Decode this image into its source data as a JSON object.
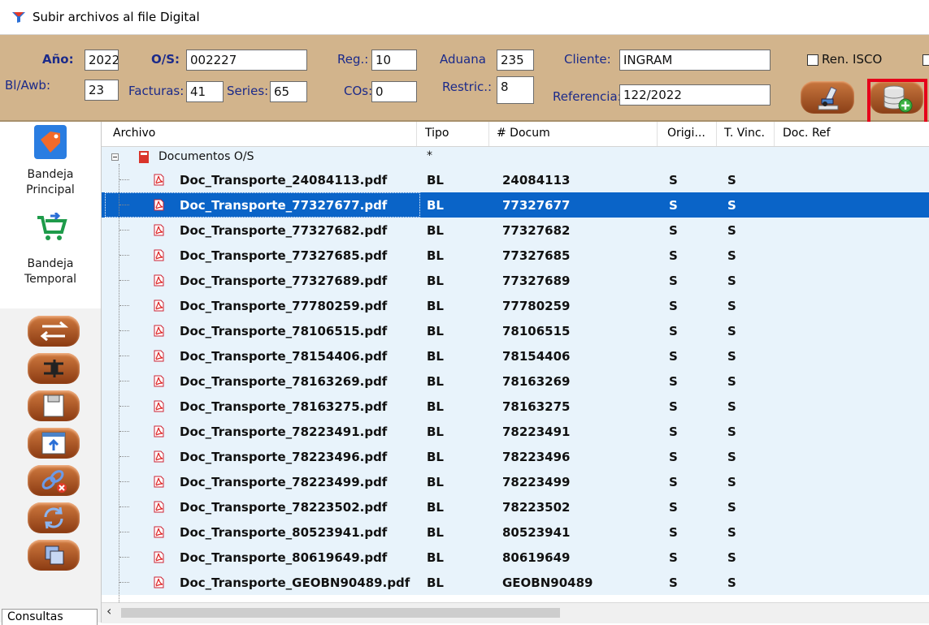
{
  "window": {
    "title": "Subir archivos al file Digital"
  },
  "header": {
    "anio_label": "Año:",
    "anio_value": "2022",
    "os_label": "O/S:",
    "os_value": "002227",
    "reg_label": "Reg.:",
    "reg_value": "10",
    "aduana_label": "Aduana",
    "aduana_value": "235",
    "cliente_label": "Cliente:",
    "cliente_value": "INGRAM",
    "ren_isco_label": "Ren. ISCO",
    "blawb_label": "Bl/Awb:",
    "blawb_value": "23",
    "facturas_label": "Facturas:",
    "facturas_value": "41",
    "series_label": "Series:",
    "series_value": "65",
    "cos_label": "COs:",
    "cos_value": "0",
    "restric_label": "Restric.:",
    "restric_value": "8",
    "referencia_label": "Referencia:",
    "referencia_value": "122/2022"
  },
  "sidebar": {
    "principal_label": "Bandeja\nPrincipal",
    "temporal_label": "Bandeja\nTemporal",
    "bottom_tab": "Consultas"
  },
  "grid": {
    "columns": [
      "Archivo",
      "Tipo",
      "# Docum",
      "Origi...",
      "T. Vinc.",
      "Doc. Ref"
    ],
    "group": {
      "name": "Documentos O/S",
      "tipo": "*"
    },
    "rows": [
      {
        "archivo": "Doc_Transporte_24084113.pdf",
        "tipo": "BL",
        "docum": "24084113",
        "origi": "S",
        "tvinc": "S"
      },
      {
        "archivo": "Doc_Transporte_77327677.pdf",
        "tipo": "BL",
        "docum": "77327677",
        "origi": "S",
        "tvinc": "S",
        "selected": true
      },
      {
        "archivo": "Doc_Transporte_77327682.pdf",
        "tipo": "BL",
        "docum": "77327682",
        "origi": "S",
        "tvinc": "S"
      },
      {
        "archivo": "Doc_Transporte_77327685.pdf",
        "tipo": "BL",
        "docum": "77327685",
        "origi": "S",
        "tvinc": "S"
      },
      {
        "archivo": "Doc_Transporte_77327689.pdf",
        "tipo": "BL",
        "docum": "77327689",
        "origi": "S",
        "tvinc": "S"
      },
      {
        "archivo": "Doc_Transporte_77780259.pdf",
        "tipo": "BL",
        "docum": "77780259",
        "origi": "S",
        "tvinc": "S"
      },
      {
        "archivo": "Doc_Transporte_78106515.pdf",
        "tipo": "BL",
        "docum": "78106515",
        "origi": "S",
        "tvinc": "S"
      },
      {
        "archivo": "Doc_Transporte_78154406.pdf",
        "tipo": "BL",
        "docum": "78154406",
        "origi": "S",
        "tvinc": "S"
      },
      {
        "archivo": "Doc_Transporte_78163269.pdf",
        "tipo": "BL",
        "docum": "78163269",
        "origi": "S",
        "tvinc": "S"
      },
      {
        "archivo": "Doc_Transporte_78163275.pdf",
        "tipo": "BL",
        "docum": "78163275",
        "origi": "S",
        "tvinc": "S"
      },
      {
        "archivo": "Doc_Transporte_78223491.pdf",
        "tipo": "BL",
        "docum": "78223491",
        "origi": "S",
        "tvinc": "S"
      },
      {
        "archivo": "Doc_Transporte_78223496.pdf",
        "tipo": "BL",
        "docum": "78223496",
        "origi": "S",
        "tvinc": "S"
      },
      {
        "archivo": "Doc_Transporte_78223499.pdf",
        "tipo": "BL",
        "docum": "78223499",
        "origi": "S",
        "tvinc": "S"
      },
      {
        "archivo": "Doc_Transporte_78223502.pdf",
        "tipo": "BL",
        "docum": "78223502",
        "origi": "S",
        "tvinc": "S"
      },
      {
        "archivo": "Doc_Transporte_80523941.pdf",
        "tipo": "BL",
        "docum": "80523941",
        "origi": "S",
        "tvinc": "S"
      },
      {
        "archivo": "Doc_Transporte_80619649.pdf",
        "tipo": "BL",
        "docum": "80619649",
        "origi": "S",
        "tvinc": "S"
      },
      {
        "archivo": "Doc_Transporte_GEOBN90489.pdf",
        "tipo": "BL",
        "docum": "GEOBN90489",
        "origi": "S",
        "tvinc": "S"
      }
    ]
  },
  "colors": {
    "header_bg": "#d2b48c",
    "label_blue": "#1b2a8a",
    "selection": "#0a64c8",
    "row_bg": "#e8f3fb",
    "highlight_red": "#e5001a"
  }
}
